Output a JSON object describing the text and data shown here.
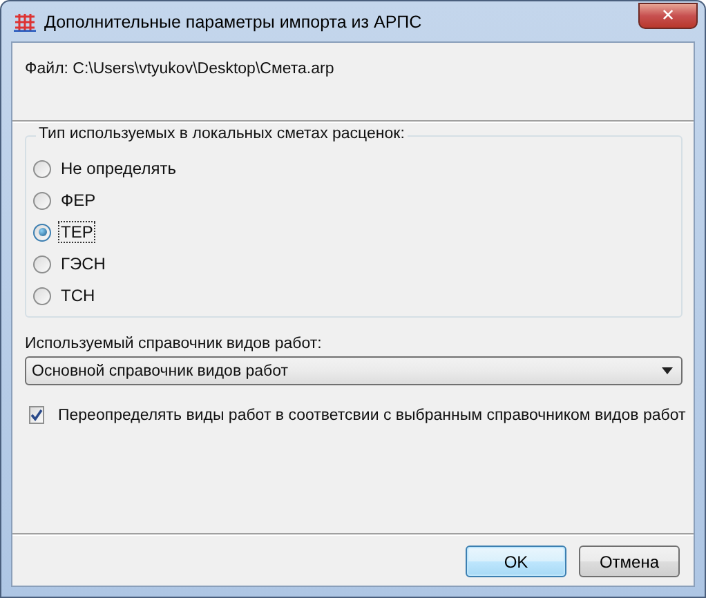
{
  "window": {
    "title": "Дополнительные параметры импорта из АРПС",
    "close": "✕"
  },
  "file_label": "Файл: C:\\Users\\vtyukov\\Desktop\\Смета.arp",
  "group": {
    "title": "Тип используемых в локальных сметах расценок:",
    "options": [
      {
        "label": "Не определять",
        "selected": false
      },
      {
        "label": "ФЕР",
        "selected": false
      },
      {
        "label": "ТЕР",
        "selected": true
      },
      {
        "label": "ГЭСН",
        "selected": false
      },
      {
        "label": "ТСН",
        "selected": false
      }
    ]
  },
  "directory": {
    "label": "Используемый справочник видов работ:",
    "value": "Основной справочник видов работ"
  },
  "override": {
    "label": "Переопределять виды работ в соответсвии с выбранным справочником видов работ",
    "checked": true
  },
  "buttons": [
    {
      "label": "OK",
      "default": true
    },
    {
      "label": "Отмена",
      "default": false
    }
  ]
}
